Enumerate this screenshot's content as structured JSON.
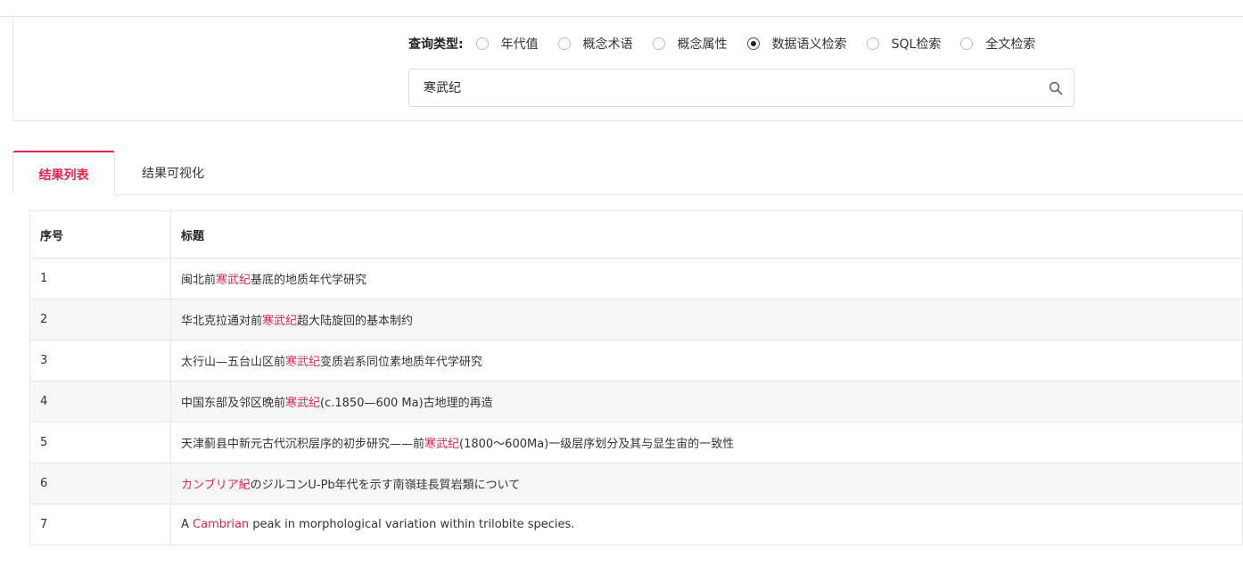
{
  "search": {
    "type_label": "查询类型:",
    "options": [
      {
        "label": "年代值",
        "checked": false
      },
      {
        "label": "概念术语",
        "checked": false
      },
      {
        "label": "概念属性",
        "checked": false
      },
      {
        "label": "数据语义检索",
        "checked": true
      },
      {
        "label": "SQL检索",
        "checked": false
      },
      {
        "label": "全文检索",
        "checked": false
      }
    ],
    "query": "寒武纪",
    "icon": "search-icon"
  },
  "tabs": [
    {
      "label": "结果列表",
      "active": true
    },
    {
      "label": "结果可视化",
      "active": false
    }
  ],
  "colors": {
    "accent": "#e1254d",
    "stripe": "#f7f7f7",
    "border": "#e6e6e6"
  },
  "table": {
    "headers": [
      "序号",
      "标题"
    ],
    "rows": [
      {
        "index": "1",
        "title_parts": [
          [
            "闽北前",
            false
          ],
          [
            "寒武纪",
            true
          ],
          [
            "基底的地质年代学研究",
            false
          ]
        ]
      },
      {
        "index": "2",
        "title_parts": [
          [
            "华北克拉通对前",
            false
          ],
          [
            "寒武纪",
            true
          ],
          [
            "超大陆旋回的基本制约",
            false
          ]
        ]
      },
      {
        "index": "3",
        "title_parts": [
          [
            "太行山—五台山区前",
            false
          ],
          [
            "寒武纪",
            true
          ],
          [
            "变质岩系同位素地质年代学研究",
            false
          ]
        ]
      },
      {
        "index": "4",
        "title_parts": [
          [
            "中国东部及邻区晚前",
            false
          ],
          [
            "寒武纪",
            true
          ],
          [
            "(c.1850—600 Ma)古地理的再造",
            false
          ]
        ]
      },
      {
        "index": "5",
        "title_parts": [
          [
            "天津蓟县中新元古代沉积层序的初步研究——前",
            false
          ],
          [
            "寒武纪",
            true
          ],
          [
            "(1800～600Ma)一级层序划分及其与显生宙的一致性",
            false
          ]
        ]
      },
      {
        "index": "6",
        "title_parts": [
          [
            "カンブリア紀",
            true
          ],
          [
            "のジルコンU-Pb年代を示す南嶺珪長質岩類について",
            false
          ]
        ]
      },
      {
        "index": "7",
        "title_parts": [
          [
            "A ",
            false
          ],
          [
            "Cambrian",
            true
          ],
          [
            " peak in morphological variation within trilobite species.",
            false
          ]
        ]
      }
    ]
  }
}
